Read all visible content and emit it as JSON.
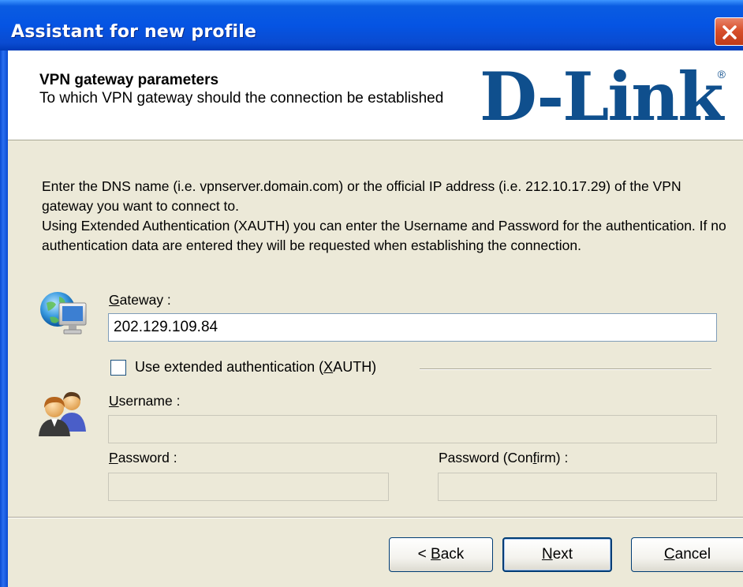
{
  "window": {
    "title": "Assistant for new profile"
  },
  "header": {
    "title": "VPN gateway parameters",
    "subtitle": "To which VPN gateway should the connection be established",
    "logo_text": "D-Link",
    "logo_reg": "®"
  },
  "description": {
    "para1": "Enter the DNS name (i.e. vpnserver.domain.com) or the official IP address (i.e. 212.10.17.29) of the VPN gateway you want to connect to.",
    "para2": "Using Extended Authentication (XAUTH) you can enter the Username and Password for the authentication. If no authentication data are entered they will be requested when establishing the connection."
  },
  "gateway": {
    "label_accel": "G",
    "label_rest": "ateway :",
    "value": "202.129.109.84"
  },
  "xauth": {
    "checked": false,
    "label_pre": "Use extended authentication (",
    "label_accel": "X",
    "label_post": "AUTH)"
  },
  "username": {
    "label_accel": "U",
    "label_rest": "sername :",
    "value": ""
  },
  "password": {
    "label_accel": "P",
    "label_rest": "assword :",
    "value": ""
  },
  "password_confirm": {
    "label_pre": "Password (Con",
    "label_accel": "f",
    "label_post": "irm) :",
    "value": ""
  },
  "buttons": {
    "back_pre": "< ",
    "back_accel": "B",
    "back_post": "ack",
    "next_accel": "N",
    "next_post": "ext",
    "cancel_accel": "C",
    "cancel_post": "ancel"
  },
  "colors": {
    "titlebar": "#0554e3",
    "dialog_bg": "#ece9d8",
    "logo": "#0f4f8d"
  },
  "icons": [
    "close-icon",
    "network-globe-icon",
    "users-icon",
    "checkbox"
  ]
}
